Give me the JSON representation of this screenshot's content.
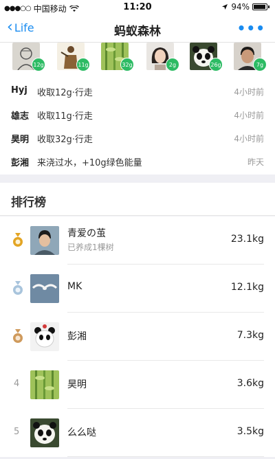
{
  "status_bar": {
    "carrier": "中国移动",
    "time": "11:20",
    "battery": "94%"
  },
  "nav": {
    "back_label": "Life",
    "title": "蚂蚁森林",
    "more_label": "•••"
  },
  "avatars": [
    {
      "badge": "12g",
      "icon": "sketch-portrait"
    },
    {
      "badge": "11g",
      "icon": "warrior-figure"
    },
    {
      "badge": "32g",
      "icon": "bamboo-forest"
    },
    {
      "badge": "2g",
      "icon": "woman-portrait"
    },
    {
      "badge": "26g",
      "icon": "panda-face"
    },
    {
      "badge": "7g",
      "icon": "man-portrait"
    }
  ],
  "feed": [
    {
      "name": "Hyj",
      "action": "收取12g·行走",
      "time": "4小时前"
    },
    {
      "name": "雄志",
      "action": "收取11g·行走",
      "time": "4小时前"
    },
    {
      "name": "昊明",
      "action": "收取32g·行走",
      "time": "4小时前"
    },
    {
      "name": "彭湘",
      "action": "来浇过水，+10g绿色能量",
      "time": "昨天"
    }
  ],
  "rank": {
    "title": "排行榜",
    "items": [
      {
        "medal": "gold",
        "rank": "",
        "name": "青爱の茧",
        "sub": "已养成1棵树",
        "value": "23.1kg"
      },
      {
        "medal": "silver",
        "rank": "",
        "name": "MK",
        "sub": "",
        "value": "12.1kg"
      },
      {
        "medal": "bronze",
        "rank": "",
        "name": "彭湘",
        "sub": "",
        "value": "7.3kg"
      },
      {
        "medal": "",
        "rank": "4",
        "name": "昊明",
        "sub": "",
        "value": "3.6kg"
      },
      {
        "medal": "",
        "rank": "5",
        "name": "么么哒",
        "sub": "",
        "value": "3.5kg"
      }
    ]
  },
  "colors": {
    "accent": "#1a8cf0",
    "energy_green": "#2dbb64",
    "gold": "#e3a524",
    "silver": "#a8c4dc",
    "bronze": "#cf9a5c"
  }
}
